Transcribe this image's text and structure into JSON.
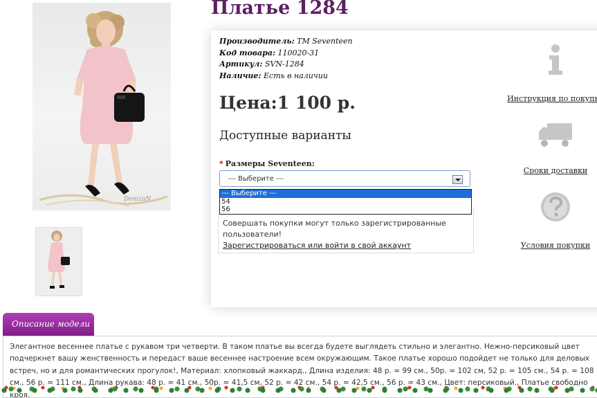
{
  "product": {
    "title": "Платье 1284",
    "manufacturer_label": "Производитель:",
    "manufacturer_value": "ТМ Seventeen",
    "code_label": "Код товара:",
    "code_value": "110020-31",
    "sku_label": "Артикул:",
    "sku_value": "SVN-1284",
    "stock_label": "Наличие:",
    "stock_value": "Есть в наличии",
    "price": "Цена:1 100 р."
  },
  "options": {
    "heading": "Доступные варианты",
    "size_label": "Размеры Seventeen:",
    "required_mark": "*",
    "select_value": "--- Выберите ---",
    "dropdown_options": [
      "--- Выберите ---",
      "54",
      "56"
    ]
  },
  "notice": {
    "text": "Совершать покупки могут только зарегистрированные пользователи!",
    "link": "Зарегистрироваться или войти в свой аккаунт"
  },
  "sidebar": {
    "items": [
      {
        "label": "Инструкция по покупке",
        "icon": "info-icon"
      },
      {
        "label": "Сроки доставки",
        "icon": "truck-icon"
      },
      {
        "label": "Условия покупки",
        "icon": "question-icon"
      }
    ]
  },
  "description": {
    "tab_label": "Описание модели",
    "text": "Элегантное весеннее платье с рукавом три четверти. В таком платье вы всегда будете выглядеть стильно и элегантно. Нежно-персиковый цвет подчеркнет вашу женственность и передаст ваше весеннее настроение всем окружающим. Такое платье хорошо подойдет не только для деловых встреч, но и для романтических прогулок!, Материал: хлопковый жаккард., Длина изделия: 48 р. = 99 см., 50р. = 102 см, 52 р. = 105 см., 54 р. = 108 см., 56 р. = 111 см., Длина рукава: 48 р. = 41 см., 50р. = 41,5 см, 52 р. = 42 см., 54 р. = 42,5 см., 56 р. = 43 см., Цвет: персиковый., Платье свободно кроя."
  },
  "images": {
    "watermark": "DenizaN"
  },
  "colors": {
    "title": "#5c2062",
    "tab": "#9b2aa3",
    "dress": "#f2c3c8"
  }
}
